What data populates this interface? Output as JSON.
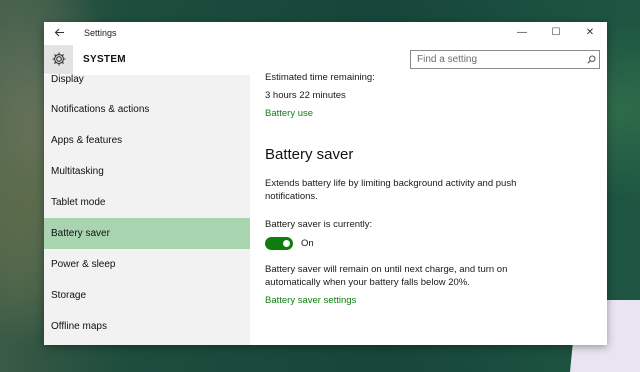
{
  "window": {
    "title": "Settings",
    "back_icon": "arrow-left-icon",
    "controls": {
      "minimize": "—",
      "maximize": "☐",
      "close": "✕"
    }
  },
  "header": {
    "icon": "gear-icon",
    "section": "SYSTEM",
    "search_placeholder": "Find a setting"
  },
  "sidebar": {
    "items": [
      {
        "label": "Display",
        "active": false
      },
      {
        "label": "Notifications & actions",
        "active": false
      },
      {
        "label": "Apps & features",
        "active": false
      },
      {
        "label": "Multitasking",
        "active": false
      },
      {
        "label": "Tablet mode",
        "active": false
      },
      {
        "label": "Battery saver",
        "active": true
      },
      {
        "label": "Power & sleep",
        "active": false
      },
      {
        "label": "Storage",
        "active": false
      },
      {
        "label": "Offline maps",
        "active": false
      }
    ]
  },
  "content": {
    "estimated_label": "Estimated time remaining:",
    "estimated_value": "3 hours 22 minutes",
    "battery_use_link": "Battery use",
    "heading": "Battery saver",
    "description_line1": "Extends battery life by limiting background activity and push",
    "description_line2": "notifications.",
    "status_label": "Battery saver is currently:",
    "toggle_state": "On",
    "note_line1": "Battery saver will remain on until next charge, and turn on",
    "note_line2": "automatically when your battery falls below 20%.",
    "settings_link": "Battery saver settings"
  },
  "colors": {
    "accent": "#107c10",
    "sidebar_active": "#a9d4b0",
    "sidebar_bg": "#f2f2f2"
  }
}
